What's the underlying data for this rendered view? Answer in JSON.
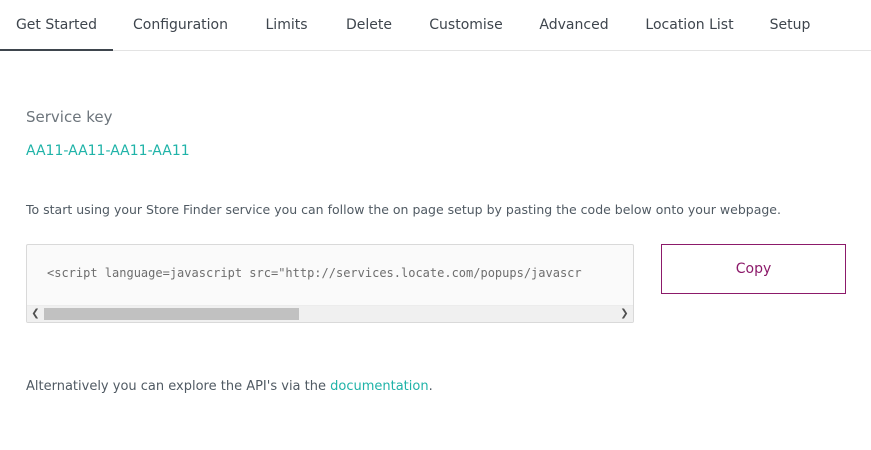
{
  "tabs": [
    {
      "label": "Get Started",
      "active": true
    },
    {
      "label": "Configuration",
      "active": false
    },
    {
      "label": "Limits",
      "active": false
    },
    {
      "label": "Delete",
      "active": false
    },
    {
      "label": "Customise",
      "active": false
    },
    {
      "label": "Advanced",
      "active": false
    },
    {
      "label": "Location List",
      "active": false
    },
    {
      "label": "Setup",
      "active": false
    }
  ],
  "service": {
    "label": "Service key",
    "key": "AA11-AA11-AA11-AA11"
  },
  "instruction": "To start using your Store Finder service you can follow the on page setup by pasting the code below onto your webpage.",
  "code": {
    "snippet": "<script language=javascript src=\"http://services.locate.com/popups/javascr"
  },
  "copy_button": {
    "label": "Copy"
  },
  "footer": {
    "prefix": "Alternatively you can explore the API's via the ",
    "link_text": "documentation",
    "suffix": "."
  },
  "colors": {
    "accent_teal": "#1fb3a8",
    "accent_purple": "#8c1a6a"
  },
  "icons": {
    "scroll_left": "chevron-left-icon",
    "scroll_right": "chevron-right-icon"
  }
}
